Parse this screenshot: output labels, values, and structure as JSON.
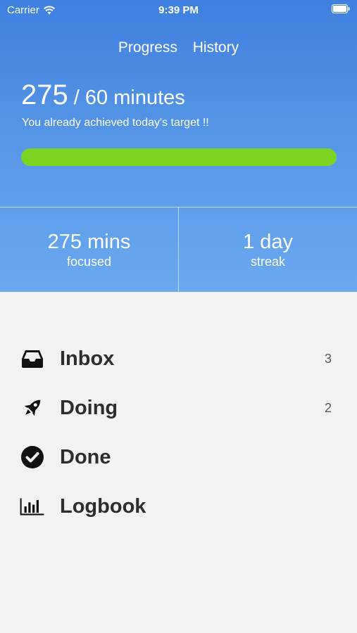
{
  "status_bar": {
    "carrier": "Carrier",
    "time": "9:39 PM"
  },
  "tabs": [
    "Progress",
    "History"
  ],
  "target": {
    "current": "275",
    "rest": " / 60 minutes",
    "message": "You already achieved today's target !!",
    "progress_fraction": 1.0
  },
  "stats": {
    "focused_value": "275 mins",
    "focused_label": "focused",
    "streak_value": "1 day",
    "streak_label": "streak"
  },
  "menu": [
    {
      "label": "Inbox",
      "count": "3",
      "icon": "inbox-icon"
    },
    {
      "label": "Doing",
      "count": "2",
      "icon": "rocket-icon"
    },
    {
      "label": "Done",
      "count": "",
      "icon": "check-circle-icon"
    },
    {
      "label": "Logbook",
      "count": "",
      "icon": "bar-chart-icon"
    }
  ],
  "colors": {
    "progress": "#7ed321",
    "header_top": "#3f7fdf",
    "header_bottom": "#6aa8ef"
  }
}
